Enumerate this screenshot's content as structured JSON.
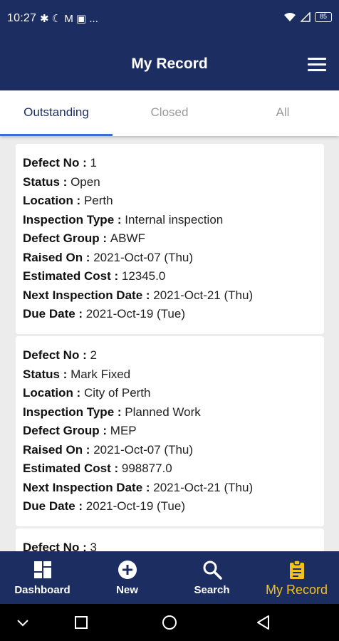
{
  "status_bar": {
    "time": "10:27",
    "indicators": "✱ ☾ M ▣ ...",
    "battery": "85"
  },
  "app": {
    "title": "My Record"
  },
  "tabs": [
    {
      "label": "Outstanding",
      "active": true
    },
    {
      "label": "Closed",
      "active": false
    },
    {
      "label": "All",
      "active": false
    }
  ],
  "defects": [
    {
      "rows": [
        {
          "label": "Defect No : ",
          "value": "1"
        },
        {
          "label": "Status : ",
          "value": "Open"
        },
        {
          "label": "Location : ",
          "value": "Perth"
        },
        {
          "label": "Inspection Type : ",
          "value": "Internal inspection"
        },
        {
          "label": "Defect Group : ",
          "value": "ABWF"
        },
        {
          "label": "Raised On : ",
          "value": "2021-Oct-07 (Thu)"
        },
        {
          "label": "Estimated Cost : ",
          "value": "12345.0"
        },
        {
          "label": "Next Inspection Date : ",
          "value": "2021-Oct-21 (Thu)"
        },
        {
          "label": "Due Date : ",
          "value": "2021-Oct-19 (Tue)"
        }
      ]
    },
    {
      "rows": [
        {
          "label": "Defect No : ",
          "value": "2"
        },
        {
          "label": "Status : ",
          "value": "Mark Fixed"
        },
        {
          "label": "Location : ",
          "value": "City of Perth"
        },
        {
          "label": "Inspection Type : ",
          "value": "Planned Work"
        },
        {
          "label": "Defect Group : ",
          "value": "MEP"
        },
        {
          "label": "Raised On : ",
          "value": "2021-Oct-07 (Thu)"
        },
        {
          "label": "Estimated Cost : ",
          "value": "998877.0"
        },
        {
          "label": "Next Inspection Date : ",
          "value": "2021-Oct-21 (Thu)"
        },
        {
          "label": "Due Date : ",
          "value": "2021-Oct-19 (Tue)"
        }
      ]
    },
    {
      "rows": [
        {
          "label": "Defect No : ",
          "value": "3"
        }
      ]
    }
  ],
  "bottom_nav": [
    {
      "label": "Dashboard",
      "icon": "dashboard-icon",
      "active": false
    },
    {
      "label": "New",
      "icon": "add-circle-icon",
      "active": false
    },
    {
      "label": "Search",
      "icon": "search-icon",
      "active": false
    },
    {
      "label": "My Record",
      "icon": "clipboard-icon",
      "active": true
    }
  ],
  "colors": {
    "primary": "#1c2d61",
    "accent": "#f2c21c",
    "tab_indicator": "#3a6fd0"
  }
}
